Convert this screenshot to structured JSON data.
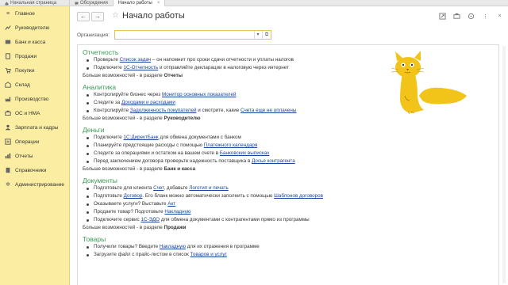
{
  "tabs": [
    {
      "label": "Начальная страница",
      "icon": "home-icon",
      "closable": false
    },
    {
      "label": "Обсуждения",
      "icon": "chat-icon",
      "closable": false
    },
    {
      "label": "Начало работы",
      "icon": "",
      "closable": true
    }
  ],
  "sidebar": {
    "items": [
      {
        "label": "Главное",
        "icon": "menu-icon"
      },
      {
        "label": "Руководителю",
        "icon": "chart-line-icon"
      },
      {
        "label": "Банк и касса",
        "icon": "bank-icon"
      },
      {
        "label": "Продажи",
        "icon": "sales-icon"
      },
      {
        "label": "Покупки",
        "icon": "cart-icon"
      },
      {
        "label": "Склад",
        "icon": "warehouse-icon"
      },
      {
        "label": "Производство",
        "icon": "production-icon"
      },
      {
        "label": "ОС и НМА",
        "icon": "assets-icon"
      },
      {
        "label": "Зарплата и кадры",
        "icon": "people-icon"
      },
      {
        "label": "Операции",
        "icon": "operations-icon"
      },
      {
        "label": "Отчеты",
        "icon": "reports-icon"
      },
      {
        "label": "Справочники",
        "icon": "book-icon"
      },
      {
        "label": "Администрирование",
        "icon": "gear-icon"
      }
    ]
  },
  "header": {
    "back": "←",
    "forward": "→",
    "title": "Начало работы",
    "icons": [
      "link-icon",
      "printer-icon",
      "chain-icon",
      "more-icon",
      "close-icon"
    ]
  },
  "org": {
    "label": "Организация:",
    "value": ""
  },
  "sections": [
    {
      "title": "Отчетность",
      "lines": [
        [
          {
            "t": "Проверьте "
          },
          {
            "t": "Список задач",
            "link": true
          },
          {
            "t": " – он напомнит про сроки сдачи отчетности и уплаты налогов"
          }
        ],
        [
          {
            "t": "Подключите "
          },
          {
            "t": "1С-Отчетность",
            "link": true
          },
          {
            "t": " и отправляйте декларации в налоговую через интернет"
          }
        ]
      ],
      "more_prefix": "Больше возможностей - в разделе ",
      "more_bold": "Отчеты"
    },
    {
      "title": "Аналитика",
      "lines": [
        [
          {
            "t": "Контролируйте бизнес через "
          },
          {
            "t": "Монитор основных показателей",
            "link": true
          }
        ],
        [
          {
            "t": "Следите за "
          },
          {
            "t": "Доходами и расходами",
            "link": true
          }
        ],
        [
          {
            "t": "Контролируйте "
          },
          {
            "t": "Задолженность покупателей",
            "link": true
          },
          {
            "t": " и смотрите, какие "
          },
          {
            "t": "Счета еще не оплачены",
            "link": true
          }
        ]
      ],
      "more_prefix": "Больше возможностей - в разделе ",
      "more_bold": "Руководителю"
    },
    {
      "title": "Деньги",
      "lines": [
        [
          {
            "t": "Подключите "
          },
          {
            "t": "1С:ДиректБанк",
            "link": true
          },
          {
            "t": " для обмена документами с банком"
          }
        ],
        [
          {
            "t": "Планируйте предстоящие расходы с помощью "
          },
          {
            "t": "Платежного календаря",
            "link": true
          }
        ],
        [
          {
            "t": "Следите за операциями и остатком на вашем счете в  "
          },
          {
            "t": "Банковских выписках",
            "link": true
          }
        ],
        [
          {
            "t": "Перед заключением договора проверьте надежность поставщика в "
          },
          {
            "t": "Досье контрагента",
            "link": true
          }
        ]
      ],
      "more_prefix": "Больше возможностей - в разделе ",
      "more_bold": "Банк и касса"
    },
    {
      "title": "Документы",
      "lines": [
        [
          {
            "t": "Подготовьте для клиента "
          },
          {
            "t": "Счет",
            "link": true
          },
          {
            "t": ", добавьте "
          },
          {
            "t": "Логотип и печать",
            "link": true
          }
        ],
        [
          {
            "t": "Подготовьте "
          },
          {
            "t": "Договор",
            "link": true
          },
          {
            "t": ". Его бланк можно автоматически заполнить с помощью "
          },
          {
            "t": "Шаблонов договоров",
            "link": true
          }
        ],
        [
          {
            "t": "Оказываете услуги? Выставьте "
          },
          {
            "t": "Акт",
            "link": true
          }
        ],
        [
          {
            "t": "Продаете товар? Подготовьте "
          },
          {
            "t": "Накладную",
            "link": true
          }
        ],
        [
          {
            "t": "Подключите сервис "
          },
          {
            "t": "1С-ЭДО",
            "link": true
          },
          {
            "t": " для обмена документами с контрагентами прямо из программы"
          }
        ]
      ],
      "more_prefix": "Больше возможностей - в разделе ",
      "more_bold": "Продажи"
    },
    {
      "title": "Товары",
      "lines": [
        [
          {
            "t": "Получили товары? Введите "
          },
          {
            "t": "Накладную",
            "link": true
          },
          {
            "t": " для их отражения в программе"
          }
        ],
        [
          {
            "t": "Загрузите файл с прайс-листом в список "
          },
          {
            "t": "Товаров и услуг",
            "link": true
          }
        ]
      ],
      "more_prefix": "",
      "more_bold": ""
    }
  ]
}
